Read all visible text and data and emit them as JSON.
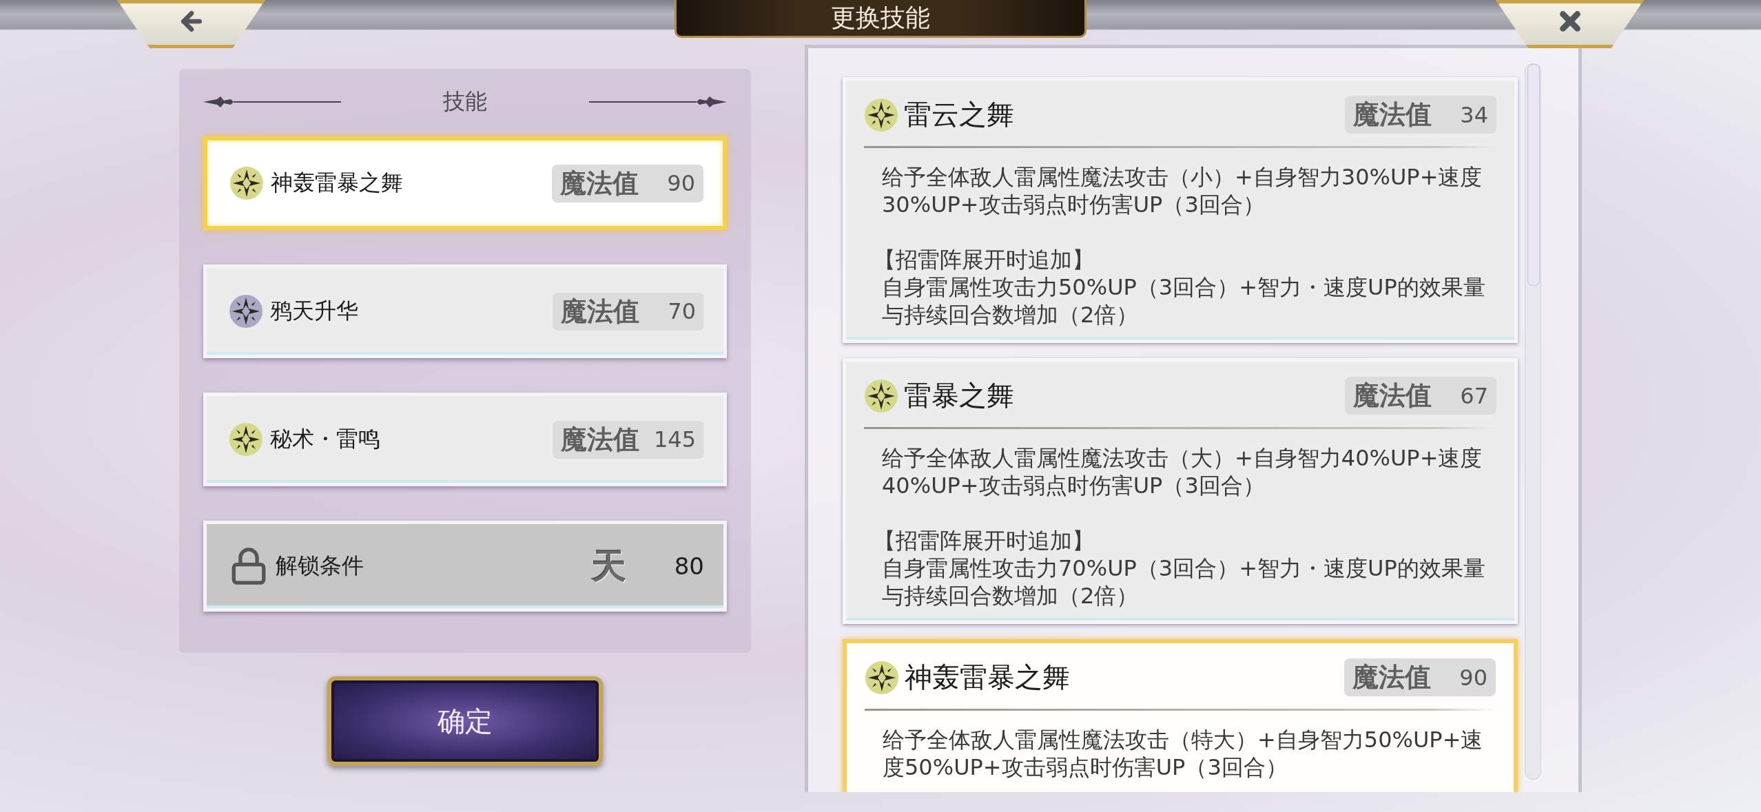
{
  "header": {
    "title": "更换技能"
  },
  "skill_list": {
    "heading": "技能",
    "items": [
      {
        "kind": "skill",
        "name": "神轰雷暴之舞",
        "mp_label": "魔法值",
        "mp": "90",
        "color": "#d6d98c",
        "selected": true
      },
      {
        "kind": "skill",
        "name": "鸦天升华",
        "mp_label": "魔法值",
        "mp": "70",
        "color": "#a9a9c6",
        "selected": false
      },
      {
        "kind": "skill",
        "name": "秘术・雷鸣",
        "mp_label": "魔法值",
        "mp": "145",
        "color": "#d6d98c",
        "selected": false
      },
      {
        "kind": "locked",
        "name": "解锁条件",
        "rank": "天",
        "mp": "80"
      }
    ]
  },
  "confirm_button": {
    "label": "确定"
  },
  "skill_details": [
    {
      "name": "雷云之舞",
      "mp_label": "魔法值",
      "mp": "34",
      "color": "#d6d98c",
      "selected": false,
      "description": "给予全体敌人雷属性魔法攻击（小）+自身智力30%UP+速度30%UP+攻击弱点时伤害UP（3回合）",
      "bonus": {
        "heading": "【招雷阵展开时追加】",
        "text": "自身雷属性攻击力50%UP（3回合）+智力・速度UP的效果量与持续回合数增加（2倍）"
      }
    },
    {
      "name": "雷暴之舞",
      "mp_label": "魔法值",
      "mp": "67",
      "color": "#d6d98c",
      "selected": false,
      "description": "给予全体敌人雷属性魔法攻击（大）+自身智力40%UP+速度40%UP+攻击弱点时伤害UP（3回合）",
      "bonus": {
        "heading": "【招雷阵展开时追加】",
        "text": "自身雷属性攻击力70%UP（3回合）+智力・速度UP的效果量与持续回合数增加（2倍）"
      }
    },
    {
      "name": "神轰雷暴之舞",
      "mp_label": "魔法值",
      "mp": "90",
      "color": "#d6d98c",
      "selected": true,
      "description": "给予全体敌人雷属性魔法攻击（特大）+自身智力50%UP+速度50%UP+攻击弱点时伤害UP（3回合）"
    }
  ]
}
